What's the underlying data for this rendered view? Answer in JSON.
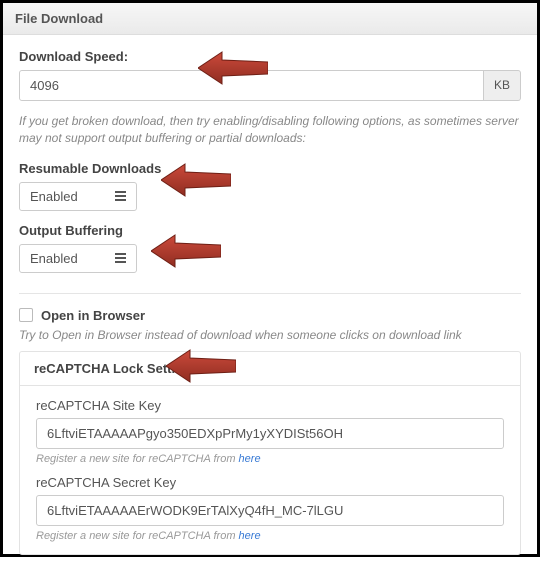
{
  "panel": {
    "title": "File Download"
  },
  "speed": {
    "label": "Download Speed:",
    "value": "4096",
    "unit": "KB"
  },
  "broken_help": "If you get broken download, then try enabling/disabling following options, as sometimes server may not support output buffering or partial downloads:",
  "resumable": {
    "label": "Resumable Downloads",
    "selected": "Enabled"
  },
  "buffering": {
    "label": "Output Buffering",
    "selected": "Enabled"
  },
  "open_in_browser": {
    "label": "Open in Browser",
    "help": "Try to Open in Browser instead of download when someone clicks on download link"
  },
  "recaptcha": {
    "panel_title": "reCAPTCHA Lock Settings",
    "site_key_label": "reCAPTCHA Site Key",
    "site_key_value": "6LftviETAAAAAPgyo350EDXpPrMy1yXYDISt56OH",
    "secret_key_label": "reCAPTCHA Secret Key",
    "secret_key_value": "6LftviETAAAAAErWODK9ErTAlXyQ4fH_MC-7lLGU",
    "hint_prefix": "Register a new site for reCAPTCHA from ",
    "hint_link": "here"
  }
}
